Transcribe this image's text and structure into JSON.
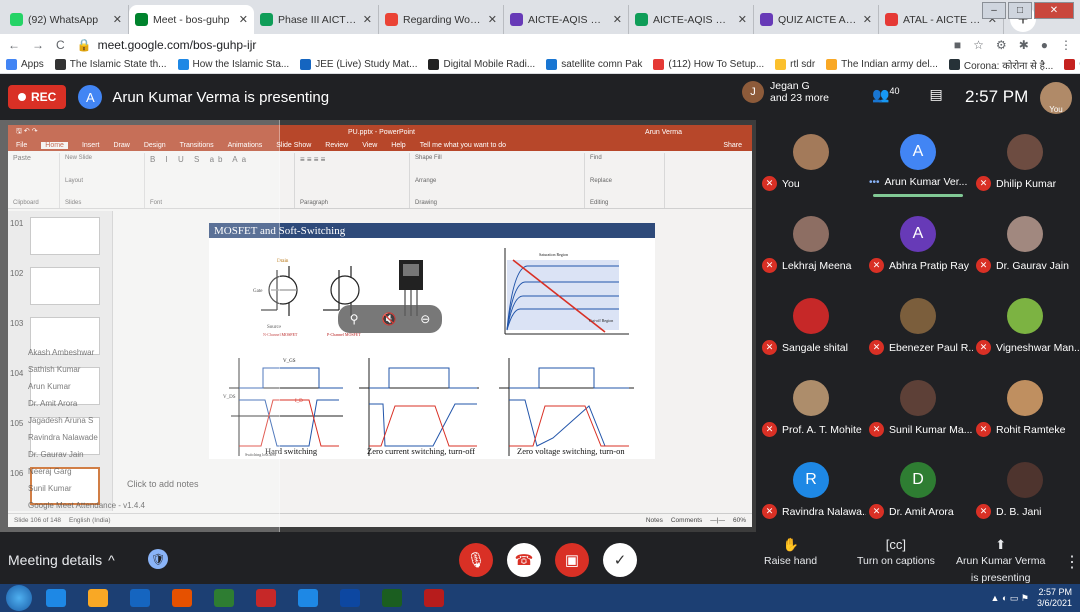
{
  "browser": {
    "tabs": [
      {
        "title": "(92) WhatsApp",
        "color": "#25d366",
        "active": false
      },
      {
        "title": "Meet - bos-guhp",
        "color": "#00832d",
        "active": true
      },
      {
        "title": "Phase III AICTE AQIS",
        "color": "#0f9d58",
        "active": false
      },
      {
        "title": "Regarding Working",
        "color": "#ea4335",
        "active": false
      },
      {
        "title": "AICTE-AQIS Sponsor",
        "color": "#673ab7",
        "active": false
      },
      {
        "title": "AICTE-AQIS Sponsor",
        "color": "#0f9d58",
        "active": false
      },
      {
        "title": "QUIZ AICTE AQIS on",
        "color": "#673ab7",
        "active": false
      },
      {
        "title": "ATAL - AICTE Trainin",
        "color": "#e53935",
        "active": false
      }
    ],
    "url": "meet.google.com/bos-guhp-ijr",
    "bookmarks": [
      "Apps",
      "The Islamic State th...",
      "How the Islamic Sta...",
      "JEE (Live) Study Mat...",
      "Digital Mobile Radi...",
      "satellite comn Pak",
      "(112) How To Setup...",
      "rtl sdr",
      "The Indian army del...",
      "Corona: कोरोना से है...",
      "Gmail"
    ],
    "bookmark_colors": [
      "#4285f4",
      "#333333",
      "#1e88e5",
      "#1565c0",
      "#222222",
      "#1976d2",
      "#e53935",
      "#fbc02d",
      "#f9a825",
      "#263238",
      "#c5221f"
    ]
  },
  "meet": {
    "rec_label": "REC",
    "presenter_initial": "A",
    "presenting_text": "Arun Kumar Verma is presenting",
    "people_name": "Jegan G",
    "people_more": "and 23 more",
    "people_initial": "J",
    "participant_count": "40",
    "time": "2:57 PM",
    "you_label": "You"
  },
  "powerpoint": {
    "file_title": "PU.pptx - PowerPoint",
    "user": "Arun Verma",
    "ribbon_tabs": [
      "File",
      "Home",
      "Insert",
      "Draw",
      "Design",
      "Transitions",
      "Animations",
      "Slide Show",
      "Review",
      "View",
      "Help",
      "Tell me what you want to do",
      "Share"
    ],
    "groups": [
      "Clipboard",
      "Slides",
      "Font",
      "Paragraph",
      "Drawing",
      "Editing"
    ],
    "ribbon_buttons": [
      "Paste",
      "New Slide",
      "Layout",
      "Reset",
      "Section",
      "Arrange",
      "Quick Styles",
      "Shape Fill",
      "Shape Outline",
      "Shape Effects",
      "Find",
      "Replace",
      "Select"
    ],
    "slide_numbers": [
      "101",
      "102",
      "103",
      "104",
      "105",
      "106"
    ],
    "slide_title": "MOSFET and Soft-Switching",
    "captions": [
      "Hard switching",
      "Zero current switching, turn-off",
      "Zero voltage switching, turn-on"
    ],
    "notes_placeholder": "Click to add notes",
    "status_left": "Slide 106 of 148",
    "language": "English (India)",
    "status_notes": "Notes",
    "status_comments": "Comments",
    "zoom": "60%",
    "diagram_labels": [
      "Drain",
      "Gate",
      "Source",
      "N-Channel MOSFET",
      "P-Channel MOSFET",
      "V_GS",
      "V_DS",
      "I_D",
      "Saturation Region",
      "Cut-off Region",
      "Switching loss area"
    ]
  },
  "participants": [
    {
      "name": "You",
      "initial": "",
      "color": "#a37a5a",
      "speaking": false
    },
    {
      "name": "Arun Kumar Ver...",
      "initial": "A",
      "color": "#4285f4",
      "speaking": true
    },
    {
      "name": "Dhilip Kumar",
      "initial": "",
      "color": "#6d4c41",
      "speaking": false
    },
    {
      "name": "Lekhraj Meena",
      "initial": "",
      "color": "#8d6e63",
      "speaking": false
    },
    {
      "name": "Abhra Pratip Ray",
      "initial": "A",
      "color": "#673ab7",
      "speaking": false
    },
    {
      "name": "Dr. Gaurav Jain",
      "initial": "",
      "color": "#a1887f",
      "speaking": false
    },
    {
      "name": "Sangale shital",
      "initial": "",
      "color": "#c62828",
      "speaking": false
    },
    {
      "name": "Ebenezer Paul R...",
      "initial": "",
      "color": "#7b5e3c",
      "speaking": false
    },
    {
      "name": "Vigneshwar Man...",
      "initial": "",
      "color": "#7cb342",
      "speaking": false
    },
    {
      "name": "Prof. A. T. Mohite",
      "initial": "",
      "color": "#ad8d6b",
      "speaking": false
    },
    {
      "name": "Sunil Kumar Ma...",
      "initial": "",
      "color": "#5d4037",
      "speaking": false
    },
    {
      "name": "Rohit Ramteke",
      "initial": "",
      "color": "#bf8f60",
      "speaking": false
    },
    {
      "name": "Ravindra Nalawa...",
      "initial": "R",
      "color": "#1e88e5",
      "speaking": false
    },
    {
      "name": "Dr. Amit Arora",
      "initial": "D",
      "color": "#2e7d32",
      "speaking": false
    },
    {
      "name": "D. B. Jani",
      "initial": "",
      "color": "#4e342e",
      "speaking": false
    }
  ],
  "bottom": {
    "meeting_details": "Meeting details",
    "raise_hand": "Raise hand",
    "captions": "Turn on captions",
    "present_line1": "Arun Kumar Verma",
    "present_line2": "is presenting"
  },
  "ghost_overlay": [
    "Akash Ambeshwar",
    "Sathish Kumar",
    "Arun Kumar",
    "Dr. Amit Arora",
    "Jagadesh Aruna S",
    "Ravindra Nalawade",
    "Dr. Gaurav Jain",
    "Neeraj Garg",
    "Sunil Kumar",
    "Google Meet Attendance - v1.4.4"
  ],
  "taskbar": {
    "apps": [
      "#1e88e5",
      "#f9a825",
      "#1565c0",
      "#e65100",
      "#2e7d32",
      "#c62828",
      "#1e88e5",
      "#0d47a1",
      "#1b5e20",
      "#b71c1c"
    ],
    "time": "2:57 PM",
    "date": "3/6/2021"
  }
}
